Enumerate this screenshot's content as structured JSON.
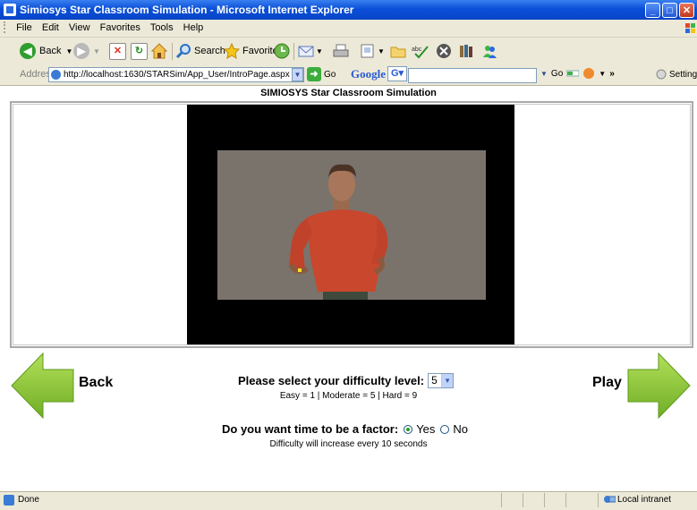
{
  "window": {
    "title": "Simiosys Star Classroom Simulation - Microsoft Internet Explorer",
    "buttons": [
      "_",
      "□",
      "✕"
    ]
  },
  "menu": [
    "File",
    "Edit",
    "View",
    "Favorites",
    "Tools",
    "Help"
  ],
  "toolbar": {
    "back_label": "Back",
    "search_label": "Search",
    "favorites_label": "Favorites"
  },
  "address": {
    "label": "Address",
    "url": "http://localhost:1630/STARSim/App_User/IntroPage.aspx",
    "go_label": "Go"
  },
  "google": {
    "logo": "Google",
    "go_label": "Go",
    "more": "»"
  },
  "settings_label": "Settings",
  "page": {
    "title": "SIMIOSYS Star Classroom Simulation",
    "back_label": "Back",
    "play_label": "Play",
    "difficulty_prompt": "Please select your difficulty level:",
    "difficulty_value": "5",
    "difficulty_note": "Easy = 1 | Moderate = 5 | Hard = 9",
    "time_prompt": "Do you want time to be a factor:",
    "time_yes": "Yes",
    "time_no": "No",
    "time_selected": "Yes",
    "time_note": "Difficulty will increase every 10 seconds"
  },
  "status": {
    "text": "Done",
    "zone": "Local intranet"
  },
  "colors": {
    "titlebar": "#0a4fd8",
    "chrome": "#ece9d8",
    "arrow_green": "#8cc63f",
    "video_bg": "#000000",
    "scene_bg": "#7d766f"
  }
}
